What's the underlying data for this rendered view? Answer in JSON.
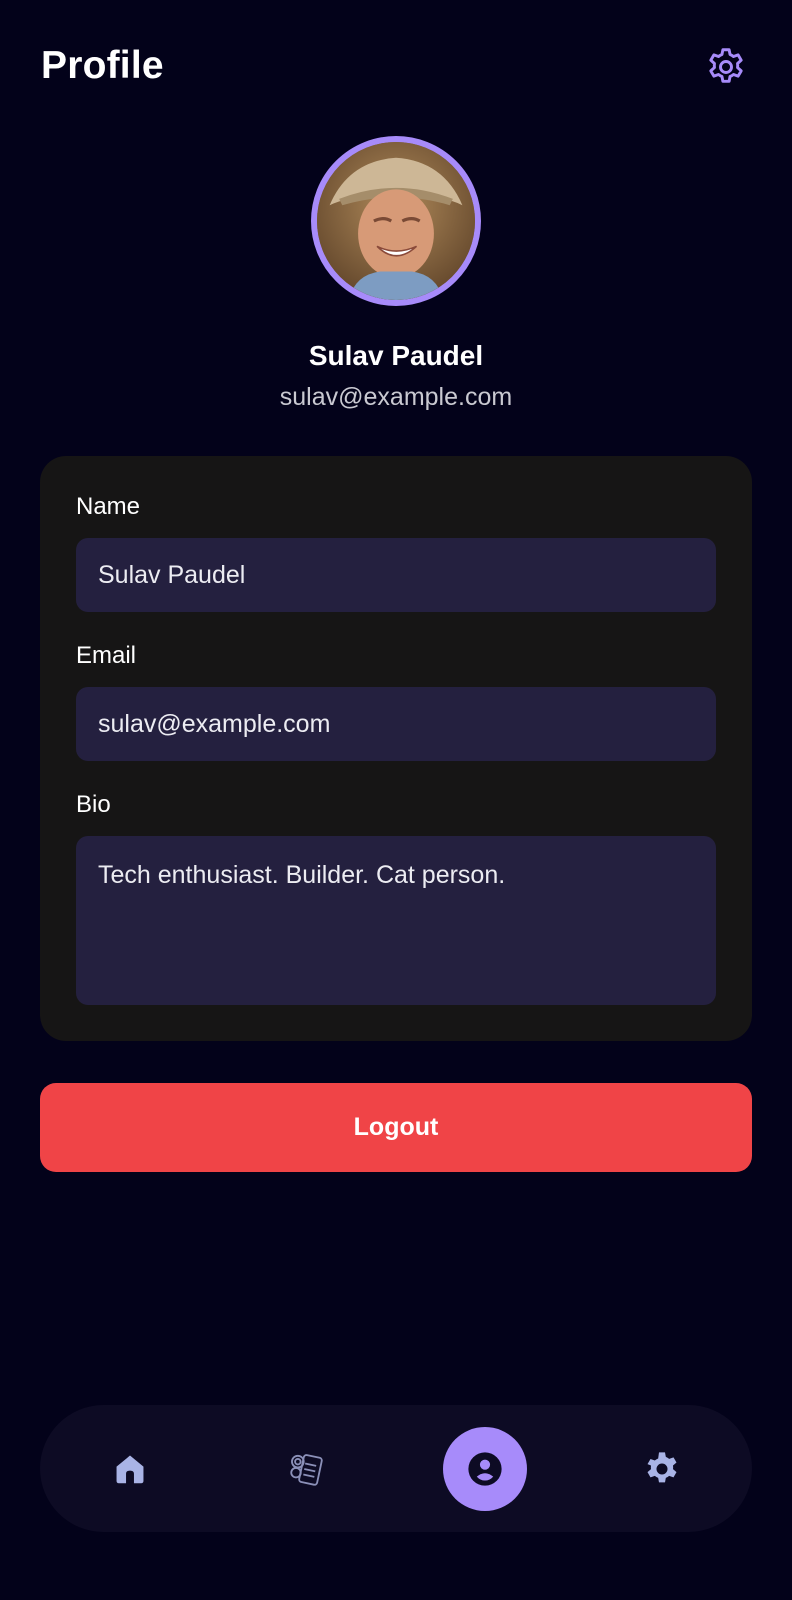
{
  "header": {
    "title": "Profile",
    "settings_icon": "gear-icon"
  },
  "profile": {
    "name": "Sulav Paudel",
    "email": "sulav@example.com",
    "avatar_icon": "avatar-photo"
  },
  "form": {
    "name_label": "Name",
    "name_value": "Sulav Paudel",
    "email_label": "Email",
    "email_value": "sulav@example.com",
    "bio_label": "Bio",
    "bio_value": "Tech enthusiast. Builder. Cat person."
  },
  "actions": {
    "logout_label": "Logout"
  },
  "bottom_nav": {
    "items": [
      {
        "icon": "home-icon",
        "active": false
      },
      {
        "icon": "coins-icon",
        "active": false
      },
      {
        "icon": "profile-icon",
        "active": true
      },
      {
        "icon": "gear-icon",
        "active": false
      }
    ]
  },
  "colors": {
    "background": "#03021a",
    "accent": "#a78bfa",
    "card": "#161515",
    "field": "#24203f",
    "danger": "#f04447",
    "nav": "#0d0b24",
    "nav_icon": "#a9b4e6"
  }
}
